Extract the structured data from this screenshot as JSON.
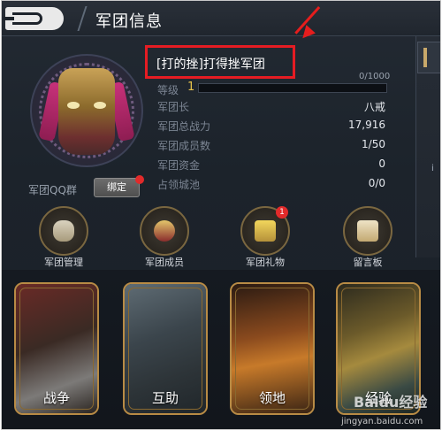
{
  "header": {
    "title": "军团信息"
  },
  "legion": {
    "name": "[打的挫]打得挫军团",
    "level_label": "等级",
    "level": "1",
    "xp": "0/1000",
    "xp_fraction": 0.0,
    "rows": [
      {
        "label": "军团长",
        "value": "八戒"
      },
      {
        "label": "军团总战力",
        "value": "17,916"
      },
      {
        "label": "军团成员数",
        "value": "1/50"
      },
      {
        "label": "军团资金",
        "value": "0"
      },
      {
        "label": "占领城池",
        "value": "0/0"
      }
    ]
  },
  "qq": {
    "label": "军团QQ群",
    "bind_label": "绑定"
  },
  "right_panel": {
    "text": "i"
  },
  "functions": [
    {
      "label": "军团管理",
      "icon": "dragon-icon"
    },
    {
      "label": "军团成员",
      "icon": "members-icon"
    },
    {
      "label": "军团礼物",
      "icon": "gift-chest-icon",
      "badge": "1"
    },
    {
      "label": "留言板",
      "icon": "scroll-icon"
    }
  ],
  "cards": [
    {
      "label": "战争"
    },
    {
      "label": "互助"
    },
    {
      "label": "领地"
    },
    {
      "label": "经验"
    }
  ],
  "watermark": {
    "text": "jingyan.baidu.com",
    "logo": "Baidu经验"
  },
  "colors": {
    "accent_gold": "#d6b44a",
    "annotation_red": "#e51c23",
    "bg": "#1c232b"
  }
}
